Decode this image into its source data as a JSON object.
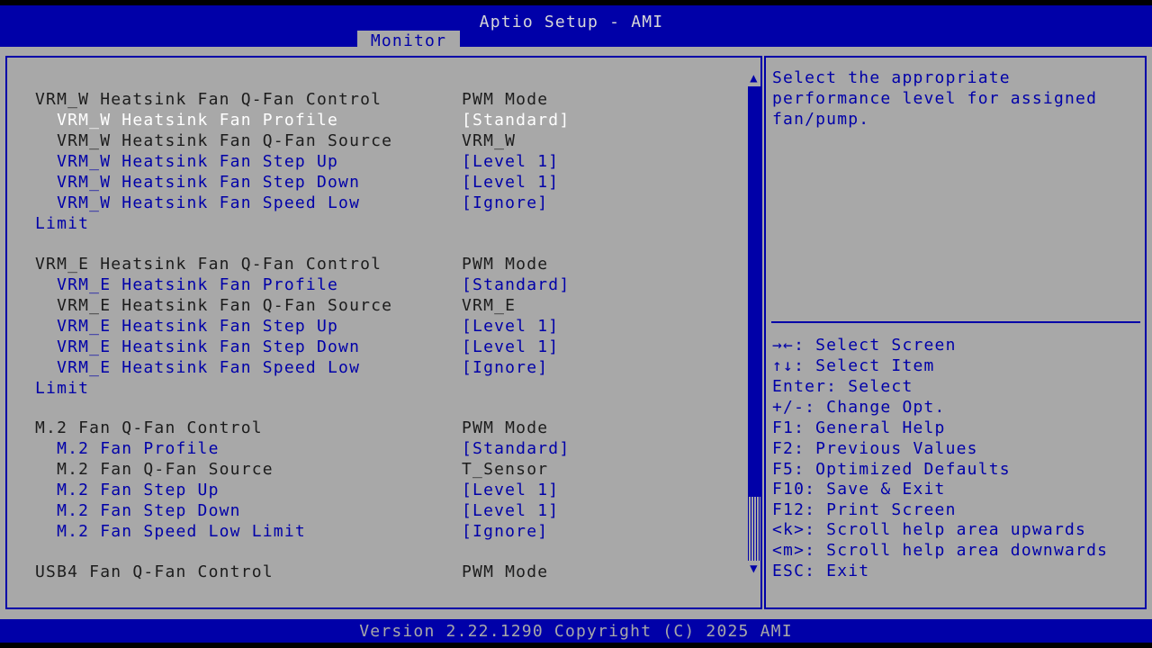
{
  "header": {
    "title": "Aptio Setup - AMI",
    "tab": "Monitor"
  },
  "settings": [
    {
      "label": "VRM_W Heatsink Fan Q-Fan Control",
      "value": "PWM Mode"
    },
    {
      "label": "  VRM_W Heatsink Fan Profile",
      "value": "[Standard]"
    },
    {
      "label": "  VRM_W Heatsink Fan Q-Fan Source",
      "value": "VRM_W"
    },
    {
      "label": "  VRM_W Heatsink Fan Step Up",
      "value": "[Level 1]"
    },
    {
      "label": "  VRM_W Heatsink Fan Step Down",
      "value": "[Level 1]"
    },
    {
      "label": "  VRM_W Heatsink Fan Speed Low",
      "label2": "Limit",
      "value": "[Ignore]"
    },
    {
      "label": "VRM_E Heatsink Fan Q-Fan Control",
      "value": "PWM Mode"
    },
    {
      "label": "  VRM_E Heatsink Fan Profile",
      "value": "[Standard]"
    },
    {
      "label": "  VRM_E Heatsink Fan Q-Fan Source",
      "value": "VRM_E"
    },
    {
      "label": "  VRM_E Heatsink Fan Step Up",
      "value": "[Level 1]"
    },
    {
      "label": "  VRM_E Heatsink Fan Step Down",
      "value": "[Level 1]"
    },
    {
      "label": "  VRM_E Heatsink Fan Speed Low",
      "label2": "Limit",
      "value": "[Ignore]"
    },
    {
      "label": "M.2 Fan Q-Fan Control",
      "value": "PWM Mode"
    },
    {
      "label": "  M.2 Fan Profile",
      "value": "[Standard]"
    },
    {
      "label": "  M.2 Fan Q-Fan Source",
      "value": "T_Sensor"
    },
    {
      "label": "  M.2 Fan Step Up",
      "value": "[Level 1]"
    },
    {
      "label": "  M.2 Fan Step Down",
      "value": "[Level 1]"
    },
    {
      "label": "  M.2 Fan Speed Low Limit",
      "value": "[Ignore]"
    },
    {
      "label": "USB4 Fan Q-Fan Control",
      "value": "PWM Mode"
    }
  ],
  "scrollbar": {
    "up_icon": "▲",
    "down_icon": "▼"
  },
  "help": {
    "lines": [
      "Select the appropriate",
      "performance level for assigned",
      "fan/pump."
    ]
  },
  "keys": [
    "→←: Select Screen",
    "↑↓: Select Item",
    "Enter: Select",
    "+/-: Change Opt.",
    "F1: General Help",
    "F2: Previous Values",
    "F5: Optimized Defaults",
    "F10: Save & Exit",
    "F12: Print Screen",
    "<k>: Scroll help area upwards",
    "<m>: Scroll help area downwards",
    "ESC: Exit"
  ],
  "footer": {
    "version": "Version 2.22.1290 Copyright (C) 2025 AMI"
  },
  "colors": {
    "bios_blue": "#0000a8",
    "panel_gray": "#a8a8a8",
    "highlight_white": "#ffffff",
    "text_dark": "#1c1c1c"
  }
}
